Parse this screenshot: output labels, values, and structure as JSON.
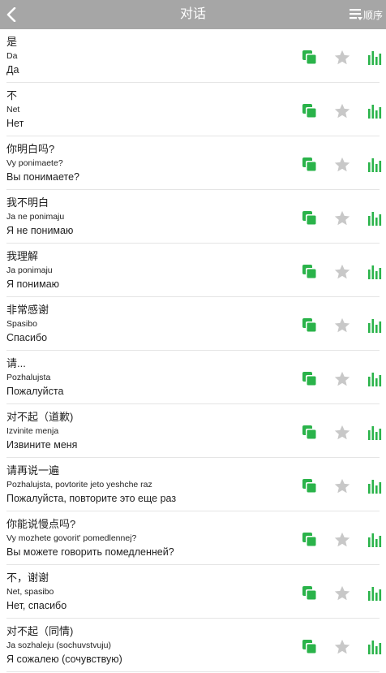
{
  "header": {
    "title": "对话",
    "order_label": "顺序"
  },
  "colors": {
    "topbar": "#a6a6a6",
    "accent_green": "#2ab34a",
    "star_gray": "#c8c8c8"
  },
  "icons": {
    "back": "chevron-left-icon",
    "order": "list-order-icon",
    "copy": "copy-icon",
    "star": "star-icon",
    "stats": "bar-chart-icon"
  },
  "phrases": [
    {
      "cn": "是",
      "translit": "Da",
      "ru": "Да"
    },
    {
      "cn": "不",
      "translit": "Net",
      "ru": "Нет"
    },
    {
      "cn": "你明白吗?",
      "translit": "Vy ponimaete?",
      "ru": "Вы понимаете?"
    },
    {
      "cn": "我不明白",
      "translit": "Ja ne ponimaju",
      "ru": "Я не понимаю"
    },
    {
      "cn": "我理解",
      "translit": "Ja ponimaju",
      "ru": "Я понимаю"
    },
    {
      "cn": "非常感谢",
      "translit": "Spasibo",
      "ru": "Спасибо"
    },
    {
      "cn": "请...",
      "translit": "Pozhalujsta",
      "ru": "Пожалуйста"
    },
    {
      "cn": "对不起（道歉)",
      "translit": "Izvinite menja",
      "ru": "Извините меня"
    },
    {
      "cn": "请再说一遍",
      "translit": "Pozhalujsta, povtorite jeto yeshche raz",
      "ru": "Пожалуйста, повторите это еще раз"
    },
    {
      "cn": "你能说慢点吗?",
      "translit": "Vy mozhete govorit' pomedlennej?",
      "ru": "Вы можете говорить помедленней?"
    },
    {
      "cn": "不，谢谢",
      "translit": "Net, spasibo",
      "ru": "Нет, спасибо"
    },
    {
      "cn": "对不起（同情)",
      "translit": "Ja sozhaleju (sochuvstvuju)",
      "ru": "Я сожалею (сочувствую)"
    }
  ]
}
